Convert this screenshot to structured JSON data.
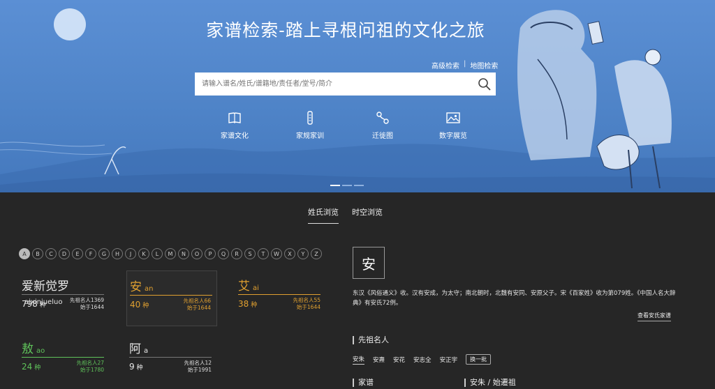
{
  "hero": {
    "title": "家谱检索-踏上寻根问祖的文化之旅",
    "advanced_search": "高级检索",
    "separator": "|",
    "map_search": "地图检索",
    "search_placeholder": "请输入谱名/姓氏/谱籍地/责任者/堂号/简介",
    "quick_links": [
      {
        "label": "家谱文化",
        "icon": "book-icon"
      },
      {
        "label": "家规家训",
        "icon": "scroll-icon"
      },
      {
        "label": "迁徙图",
        "icon": "route-icon"
      },
      {
        "label": "数字展览",
        "icon": "image-icon"
      }
    ],
    "carousel_active_index": 0
  },
  "tabs": [
    {
      "label": "姓氏浏览",
      "active": true
    },
    {
      "label": "时空浏览",
      "active": false
    }
  ],
  "alphabet": [
    "A",
    "B",
    "C",
    "D",
    "E",
    "F",
    "G",
    "H",
    "J",
    "K",
    "L",
    "M",
    "N",
    "O",
    "P",
    "Q",
    "R",
    "S",
    "T",
    "W",
    "X",
    "Y",
    "Z"
  ],
  "alphabet_selected": "A",
  "surnames": [
    {
      "name": "爱新觉罗",
      "pinyin": "aixinjueluo",
      "count": "798",
      "unit": "种",
      "ancestors": "先祖名人1369",
      "since": "始于1644",
      "color": "#e8e8e8"
    },
    {
      "name": "安",
      "pinyin": "an",
      "count": "40",
      "unit": "种",
      "ancestors": "先祖名人66",
      "since": "始于1644",
      "color": "#e0a030",
      "selected": true
    },
    {
      "name": "艾",
      "pinyin": "ai",
      "count": "38",
      "unit": "种",
      "ancestors": "先祖名人55",
      "since": "始于1644",
      "color": "#e0a030"
    },
    {
      "name": "敖",
      "pinyin": "ao",
      "count": "24",
      "unit": "种",
      "ancestors": "先祖名人27",
      "since": "始于1780",
      "color": "#5fc25a"
    },
    {
      "name": "阿",
      "pinyin": "a",
      "count": "9",
      "unit": "种",
      "ancestors": "先祖名人12",
      "since": "始于1991",
      "color": "#e8e8e8"
    }
  ],
  "detail": {
    "char": "安",
    "description": "东汉《风俗通义》收。汉有安成，为太守；南北朝时，北魏有安同、安原父子。宋《百家姓》收为第079姓。《中国人名大辞典》有安氏72例。",
    "view_link": "查看安氏家谱",
    "ancestors_title": "先祖名人",
    "ancestors": [
      "安朱",
      "安燾",
      "安花",
      "安志全",
      "安正宇"
    ],
    "refresh": "换一批",
    "genealogy_title": "家谱",
    "genealogy_right_title": "安朱 / 始遷祖"
  },
  "colors": {
    "hero_bg": "#4f84c8",
    "page_bg": "#262626",
    "accent_orange": "#e0a030",
    "accent_green": "#5fc25a"
  }
}
